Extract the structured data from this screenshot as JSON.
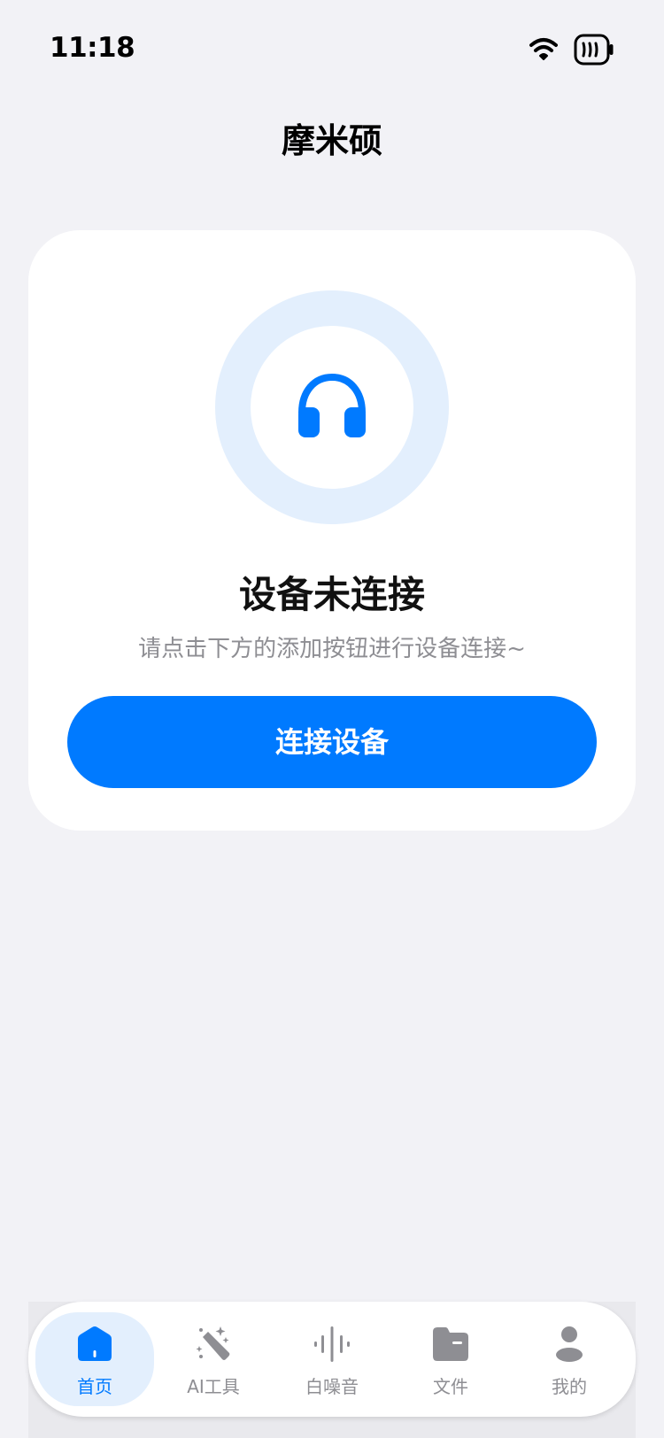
{
  "status_bar": {
    "time": "11:18",
    "icons": [
      "wifi-icon",
      "battery-icon"
    ]
  },
  "header": {
    "title": "摩米硕"
  },
  "device_card": {
    "icon": "headphones-icon",
    "title": "设备未连接",
    "subtitle": "请点击下方的添加按钮进行设备连接~",
    "button_label": "连接设备"
  },
  "tab_bar": {
    "items": [
      {
        "label": "首页",
        "icon": "home-icon",
        "active": true
      },
      {
        "label": "AI工具",
        "icon": "magic-wand-icon",
        "active": false
      },
      {
        "label": "白噪音",
        "icon": "sound-wave-icon",
        "active": false
      },
      {
        "label": "文件",
        "icon": "folder-icon",
        "active": false
      },
      {
        "label": "我的",
        "icon": "user-icon",
        "active": false
      }
    ]
  },
  "colors": {
    "accent": "#007aff",
    "accent_light": "#e3effd",
    "background": "#f2f2f6",
    "inactive": "#8e8e93"
  }
}
